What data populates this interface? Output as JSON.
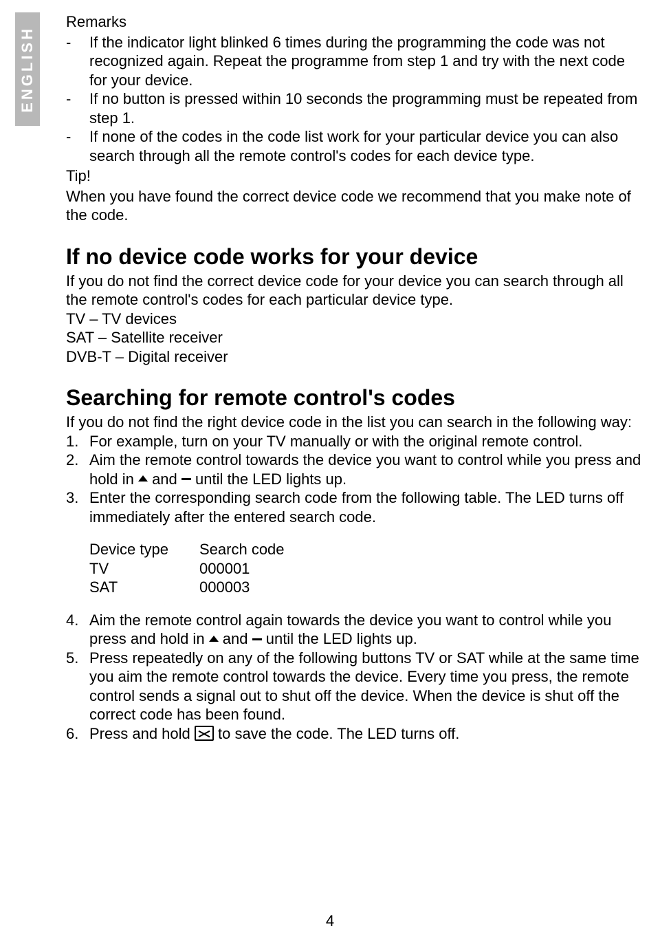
{
  "lang_tab": "ENGLISH",
  "remarks": {
    "title": "Remarks",
    "items": [
      "If the indicator light blinked 6 times during the programming the code was not recognized again. Repeat the programme from step 1 and try with the next code for your device.",
      "If no button is pressed within 10 seconds the programming must be repeated from step 1.",
      "If none of the codes in the code list work for your particular device you can also search through all the remote control's codes for each device type."
    ],
    "tip_label": "Tip!",
    "tip_text": "When you have found the correct device code we recommend that you make note of the code."
  },
  "section1": {
    "heading": "If no device code works for your device",
    "intro": "If you do not find the correct device code for your device you can search through all the remote control's codes for each particular device type.",
    "lines": [
      "TV – TV devices",
      "SAT – Satellite receiver",
      "DVB-T – Digital receiver"
    ]
  },
  "section2": {
    "heading": "Searching for remote control's codes",
    "intro": "If you do not find the right device code in the list you can search in the following way:",
    "step1": "For example, turn on your TV manually or with the original remote control.",
    "step2a": "Aim the remote control towards the device you want to control while you press and hold in ",
    "step2b": " and ",
    "step2c": " until the LED lights up.",
    "step3": "Enter the corresponding search code from the following table. The LED turns off immediately after the entered search code.",
    "table": {
      "h1": "Device type",
      "h2": "Search code",
      "rows": [
        {
          "c1": "TV",
          "c2": "000001"
        },
        {
          "c1": "SAT",
          "c2": "000003"
        }
      ]
    },
    "step4a": "Aim the remote control again towards the device you want to control while you press and hold in ",
    "step4b": " and ",
    "step4c": " until the LED lights up.",
    "step5": "Press repeatedly on any of the following buttons TV or SAT while at the same time you aim the remote control towards the device. Every time you press, the remote control sends a signal out to shut off the device. When the device is shut off the correct code has been found.",
    "step6a": "Press and hold ",
    "step6b": " to save the code. The LED turns off."
  },
  "page_number": "4"
}
